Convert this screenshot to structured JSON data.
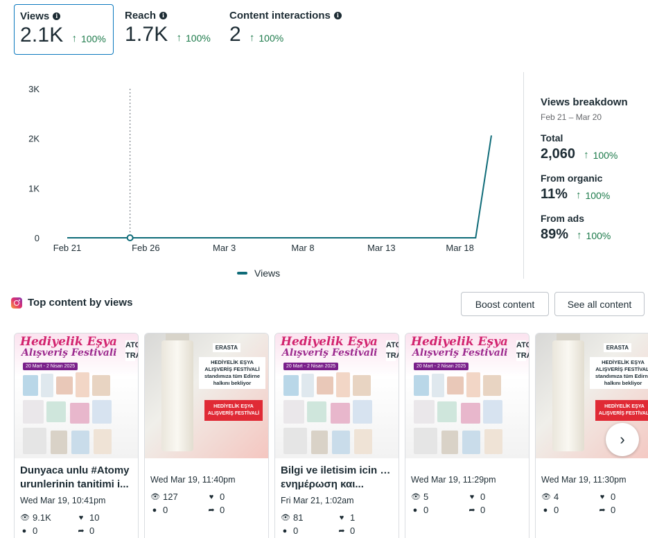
{
  "metrics": [
    {
      "label": "Views",
      "value": "2.1K",
      "change": "100%",
      "selected": true
    },
    {
      "label": "Reach",
      "value": "1.7K",
      "change": "100%",
      "selected": false
    },
    {
      "label": "Content interactions",
      "value": "2",
      "change": "100%",
      "selected": false
    }
  ],
  "chart_data": {
    "type": "line",
    "x": [
      "Feb 20",
      "Feb 21",
      "Feb 22",
      "Feb 23",
      "Feb 24",
      "Feb 25",
      "Feb 26",
      "Feb 27",
      "Feb 28",
      "Mar 1",
      "Mar 2",
      "Mar 3",
      "Mar 4",
      "Mar 5",
      "Mar 6",
      "Mar 7",
      "Mar 8",
      "Mar 9",
      "Mar 10",
      "Mar 11",
      "Mar 12",
      "Mar 13",
      "Mar 14",
      "Mar 15",
      "Mar 16",
      "Mar 17",
      "Mar 18",
      "Mar 19",
      "Mar 20"
    ],
    "series": [
      {
        "name": "Views",
        "color": "#0e6b78",
        "values": [
          0,
          0,
          0,
          0,
          0,
          0,
          0,
          0,
          0,
          0,
          0,
          0,
          0,
          0,
          0,
          0,
          0,
          0,
          0,
          0,
          0,
          0,
          0,
          0,
          0,
          0,
          0,
          0,
          2060
        ]
      }
    ],
    "xticks": [
      "Feb 21",
      "Feb 26",
      "Mar 3",
      "Mar 8",
      "Mar 13",
      "Mar 18"
    ],
    "yticks": [
      "0",
      "1K",
      "2K",
      "3K"
    ],
    "ylim": [
      0,
      3000
    ],
    "highlight_point": "Feb 25",
    "legend_position": "bottom"
  },
  "breakdown": {
    "title": "Views breakdown",
    "range": "Feb 21 – Mar 20",
    "items": [
      {
        "label": "Total",
        "value": "2,060",
        "change": "100%"
      },
      {
        "label": "From organic",
        "value": "11%",
        "change": "100%"
      },
      {
        "label": "From ads",
        "value": "89%",
        "change": "100%"
      }
    ]
  },
  "top_content": {
    "title": "Top content by views",
    "boost_label": "Boost content",
    "see_all_label": "See all content",
    "posts": [
      {
        "thumb": "festival",
        "caption1": "Dunyaca unlu #Atomy",
        "caption2": "urunlerinin tanitimi i...",
        "date": "Wed Mar 19, 10:41pm",
        "views": "9.1K",
        "likes": "10",
        "comments": "0",
        "shares": "0"
      },
      {
        "thumb": "sunscreen",
        "caption1": "",
        "caption2": "",
        "date": "Wed Mar 19, 11:40pm",
        "views": "127",
        "likes": "0",
        "comments": "0",
        "shares": "0"
      },
      {
        "thumb": "festival",
        "caption1": "Bilgi ve iletisim icin Για",
        "caption2": "ενημέρωση και...",
        "date": "Fri Mar 21, 1:02am",
        "views": "81",
        "likes": "1",
        "comments": "0",
        "shares": "0"
      },
      {
        "thumb": "festival",
        "caption1": "",
        "caption2": "",
        "date": "Wed Mar 19, 11:29pm",
        "views": "5",
        "likes": "0",
        "comments": "0",
        "shares": "0"
      },
      {
        "thumb": "sunscreen",
        "caption1": "",
        "caption2": "",
        "date": "Wed Mar 19, 11:30pm",
        "views": "4",
        "likes": "0",
        "comments": "0",
        "shares": "0"
      }
    ],
    "thumb_text": {
      "festival_title": "Hediyelik Eşya",
      "festival_sub": "Alışveriş Festivali",
      "festival_date": "20 Mart - 2 Nisan 2025",
      "festival_vertical": "ATOMY TRAKYA",
      "sun_brand": "ERASTA",
      "sun_banner": "HEDİYELİK EŞYA ALIŞVERİŞ FESTİVALİ standımıza tüm Edirne halkını bekliyor",
      "sun_red": "HEDİYELİK EŞYA ALIŞVERİŞ FESTİVALİ"
    }
  },
  "colors": {
    "accent": "#0a78be",
    "positive": "#1c7a4a",
    "line": "#0e6b78"
  }
}
